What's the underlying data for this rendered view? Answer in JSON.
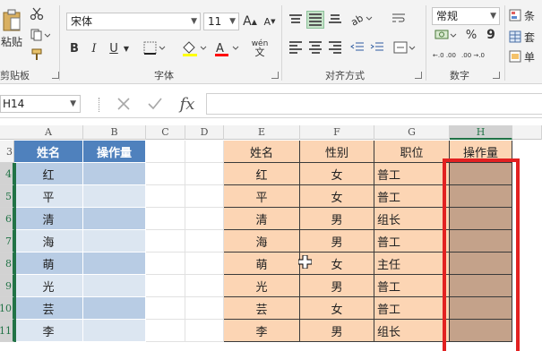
{
  "ribbon": {
    "clipboard": {
      "paste_label": "粘贴",
      "group_label": "剪贴板"
    },
    "font": {
      "font_name": "宋体",
      "font_size": "11",
      "bold": "B",
      "italic": "I",
      "underline": "U",
      "grow": "A",
      "shrink": "A",
      "phonetic": "wén",
      "group_label": "字体",
      "fill_color": "#ffff00",
      "font_color": "#ff0000"
    },
    "alignment": {
      "group_label": "对齐方式"
    },
    "number": {
      "format": "常规",
      "percent": "%",
      "comma": "9",
      "inc_decimal": "←.0 .00",
      "dec_decimal": ".00 →.0",
      "group_label": "数字"
    },
    "styles": {
      "conditional": "条",
      "table": "套",
      "cell": "单"
    }
  },
  "formula_bar": {
    "name_box": "H14",
    "formula": ""
  },
  "columns": [
    "A",
    "B",
    "C",
    "D",
    "E",
    "F",
    "G",
    "H"
  ],
  "rows": [
    "3",
    "4",
    "5",
    "6",
    "7",
    "8",
    "9",
    "10",
    "11"
  ],
  "left_table": {
    "headers": [
      "姓名",
      "操作量"
    ],
    "names": [
      "红",
      "平",
      "清",
      "海",
      "萌",
      "光",
      "芸",
      "李"
    ]
  },
  "right_table": {
    "headers": [
      "姓名",
      "性别",
      "职位",
      "操作量"
    ],
    "rows": [
      {
        "name": "红",
        "gender": "女",
        "position": "普工"
      },
      {
        "name": "平",
        "gender": "女",
        "position": "普工"
      },
      {
        "name": "清",
        "gender": "男",
        "position": "组长"
      },
      {
        "name": "海",
        "gender": "男",
        "position": "普工"
      },
      {
        "name": "萌",
        "gender": "女",
        "position": "主任"
      },
      {
        "name": "光",
        "gender": "男",
        "position": "普工"
      },
      {
        "name": "芸",
        "gender": "女",
        "position": "普工"
      },
      {
        "name": "李",
        "gender": "男",
        "position": "组长"
      }
    ]
  },
  "colors": {
    "header_blue": "#4f81bd",
    "band_blue": "#b8cce4",
    "band_light_blue": "#dce6f1",
    "peach": "#fcd5b4",
    "tan": "#c4a28a",
    "highlight_red": "#e22121",
    "excel_green": "#217346"
  }
}
